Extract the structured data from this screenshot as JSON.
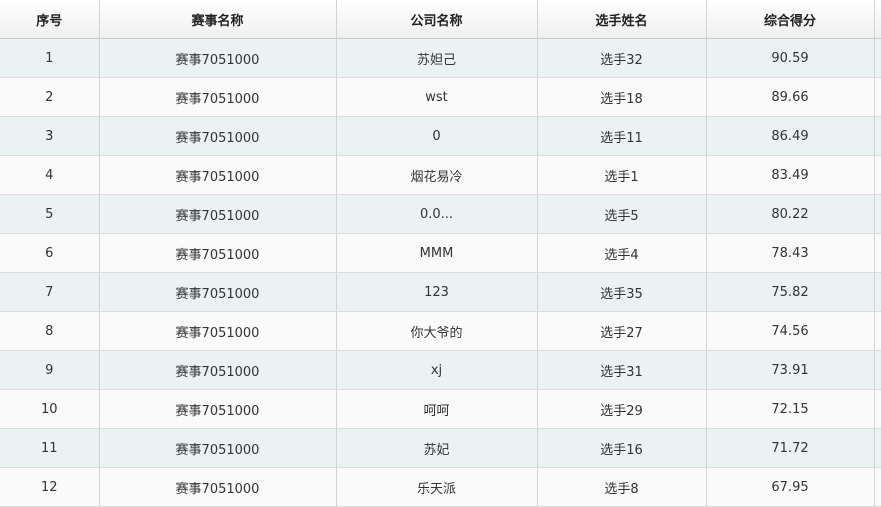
{
  "table": {
    "headers": [
      "序号",
      "赛事名称",
      "公司名称",
      "选手姓名",
      "综合得分"
    ],
    "rows": [
      [
        "1",
        "赛事7051000",
        "苏妲己",
        "选手32",
        "90.59"
      ],
      [
        "2",
        "赛事7051000",
        "wst",
        "选手18",
        "89.66"
      ],
      [
        "3",
        "赛事7051000",
        "0",
        "选手11",
        "86.49"
      ],
      [
        "4",
        "赛事7051000",
        "烟花易冷",
        "选手1",
        "83.49"
      ],
      [
        "5",
        "赛事7051000",
        "0.0...",
        "选手5",
        "80.22"
      ],
      [
        "6",
        "赛事7051000",
        "MMM",
        "选手4",
        "78.43"
      ],
      [
        "7",
        "赛事7051000",
        "123",
        "选手35",
        "75.82"
      ],
      [
        "8",
        "赛事7051000",
        "你大爷的",
        "选手27",
        "74.56"
      ],
      [
        "9",
        "赛事7051000",
        "xj",
        "选手31",
        "73.91"
      ],
      [
        "10",
        "赛事7051000",
        "呵呵",
        "选手29",
        "72.15"
      ],
      [
        "11",
        "赛事7051000",
        "苏妃",
        "选手16",
        "71.72"
      ],
      [
        "12",
        "赛事7051000",
        "乐天派",
        "选手8",
        "67.95"
      ]
    ]
  },
  "colors": {
    "row_odd": "#ecf1f4",
    "row_even": "#fafafa",
    "grid_line": "#d3d3d3"
  }
}
